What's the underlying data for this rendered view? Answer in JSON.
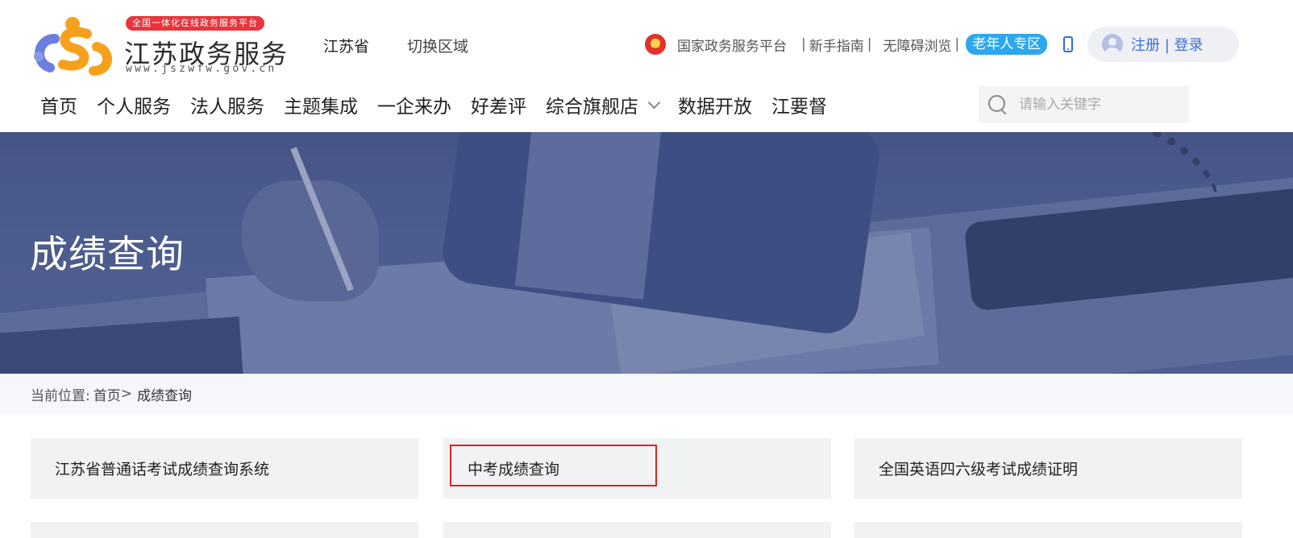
{
  "header": {
    "logo": {
      "badge": "全国一体化在线政务服务平台",
      "title": "江苏政务服务",
      "url": "www.jszwfw.gov.cn"
    },
    "region": "江苏省",
    "switch_region": "切换区域",
    "top_links": {
      "national_platform": "国家政务服务平台",
      "sep1": "|",
      "beginner_guide": "新手指南",
      "sep2": "|",
      "accessible": "无障碍浏览",
      "sep3": "|",
      "elderly_zone": "老年人专区"
    },
    "login": "注册 | 登录",
    "nav": [
      {
        "label": "首页"
      },
      {
        "label": "个人服务"
      },
      {
        "label": "法人服务"
      },
      {
        "label": "主题集成"
      },
      {
        "label": "一企来办"
      },
      {
        "label": "好差评"
      },
      {
        "label": "综合旗舰店"
      },
      {
        "label": "数据开放"
      },
      {
        "label": "江要督"
      }
    ],
    "search": {
      "placeholder": "请输入关键字",
      "value": ""
    }
  },
  "banner": {
    "title": "成绩查询"
  },
  "breadcrumb": {
    "prefix": "当前位置:",
    "home": "首页",
    "separator": ">",
    "current": "成绩查询"
  },
  "cards": [
    {
      "label": "江苏省普通话考试成绩查询系统"
    },
    {
      "label": "中考成绩查询",
      "highlighted": true
    },
    {
      "label": "全国英语四六级考试成绩证明"
    }
  ],
  "colors": {
    "brand_blue": "#3b6fd8",
    "elder_badge": "#2da8ef",
    "badge_red": "#e8343a",
    "highlight_red": "#e02020",
    "banner": "#4d5b8c"
  }
}
